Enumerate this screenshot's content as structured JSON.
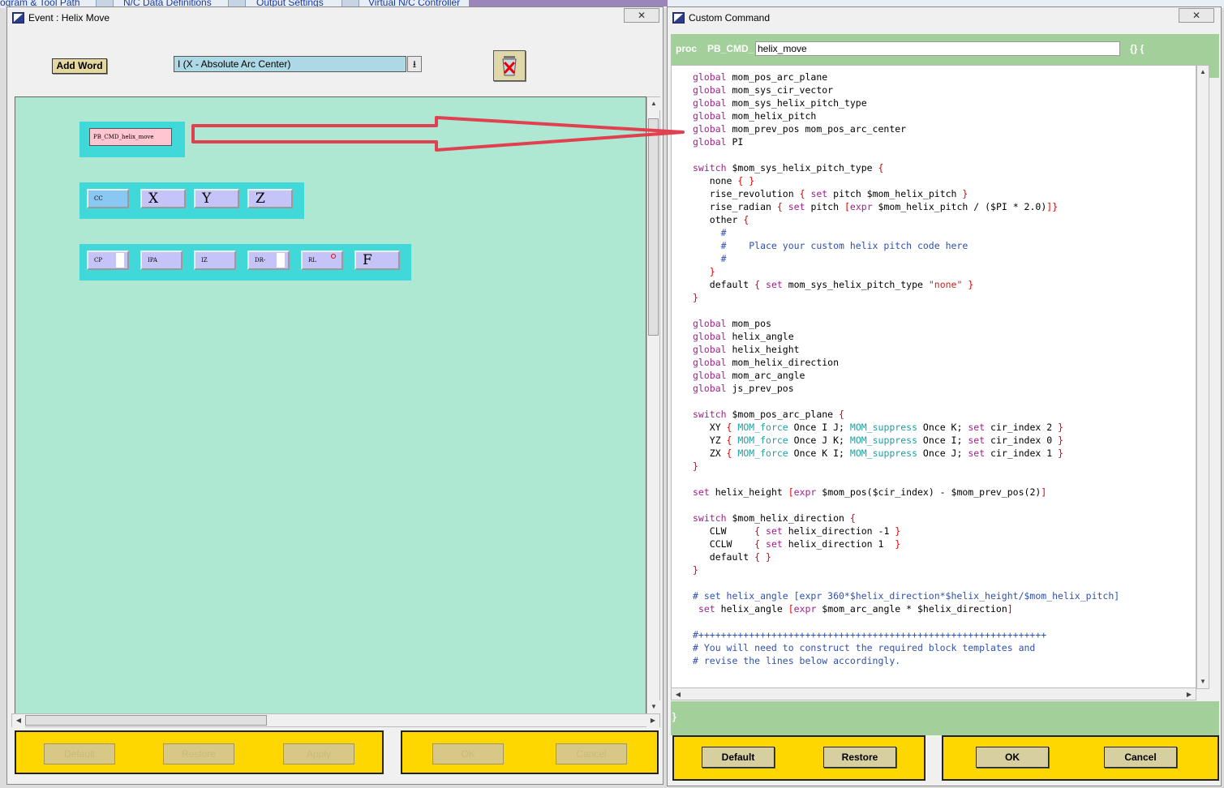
{
  "top_tabs": [
    "ogram & Tool Path",
    "N/C Data Definitions",
    "Output Settings",
    "Virtual N/C Controller"
  ],
  "event_window": {
    "title": "Event : Helix Move",
    "close": "✕",
    "add_word_label": "Add Word",
    "combo_value": "I (X - Absolute Arc Center)",
    "combo_arrow": "⭳",
    "cmd_block": "PB_CMD_helix_move",
    "row2": [
      "CC",
      "X",
      "Y",
      "Z"
    ],
    "row3": [
      "CP",
      "IPA",
      "IZ",
      "DR-",
      "RL",
      "F"
    ],
    "buttons": {
      "default": "Default",
      "restore": "Restore",
      "apply": "Apply",
      "ok": "OK",
      "cancel": "Cancel"
    }
  },
  "custom_command": {
    "title": "Custom Command",
    "close": "✕",
    "proc_label": "proc",
    "prefix": "PB_CMD_",
    "name": "helix_move",
    "braces_open": "{} {",
    "closing_brace": "}",
    "buttons": {
      "default": "Default",
      "restore": "Restore",
      "ok": "OK",
      "cancel": "Cancel"
    }
  },
  "colors": {
    "canvas": "#aee8d2",
    "group": "#40d8d8",
    "word": "#c4c4f8",
    "panel": "#ffd700",
    "proc_bar": "#a3cf9a",
    "arrow": "#e04050"
  }
}
